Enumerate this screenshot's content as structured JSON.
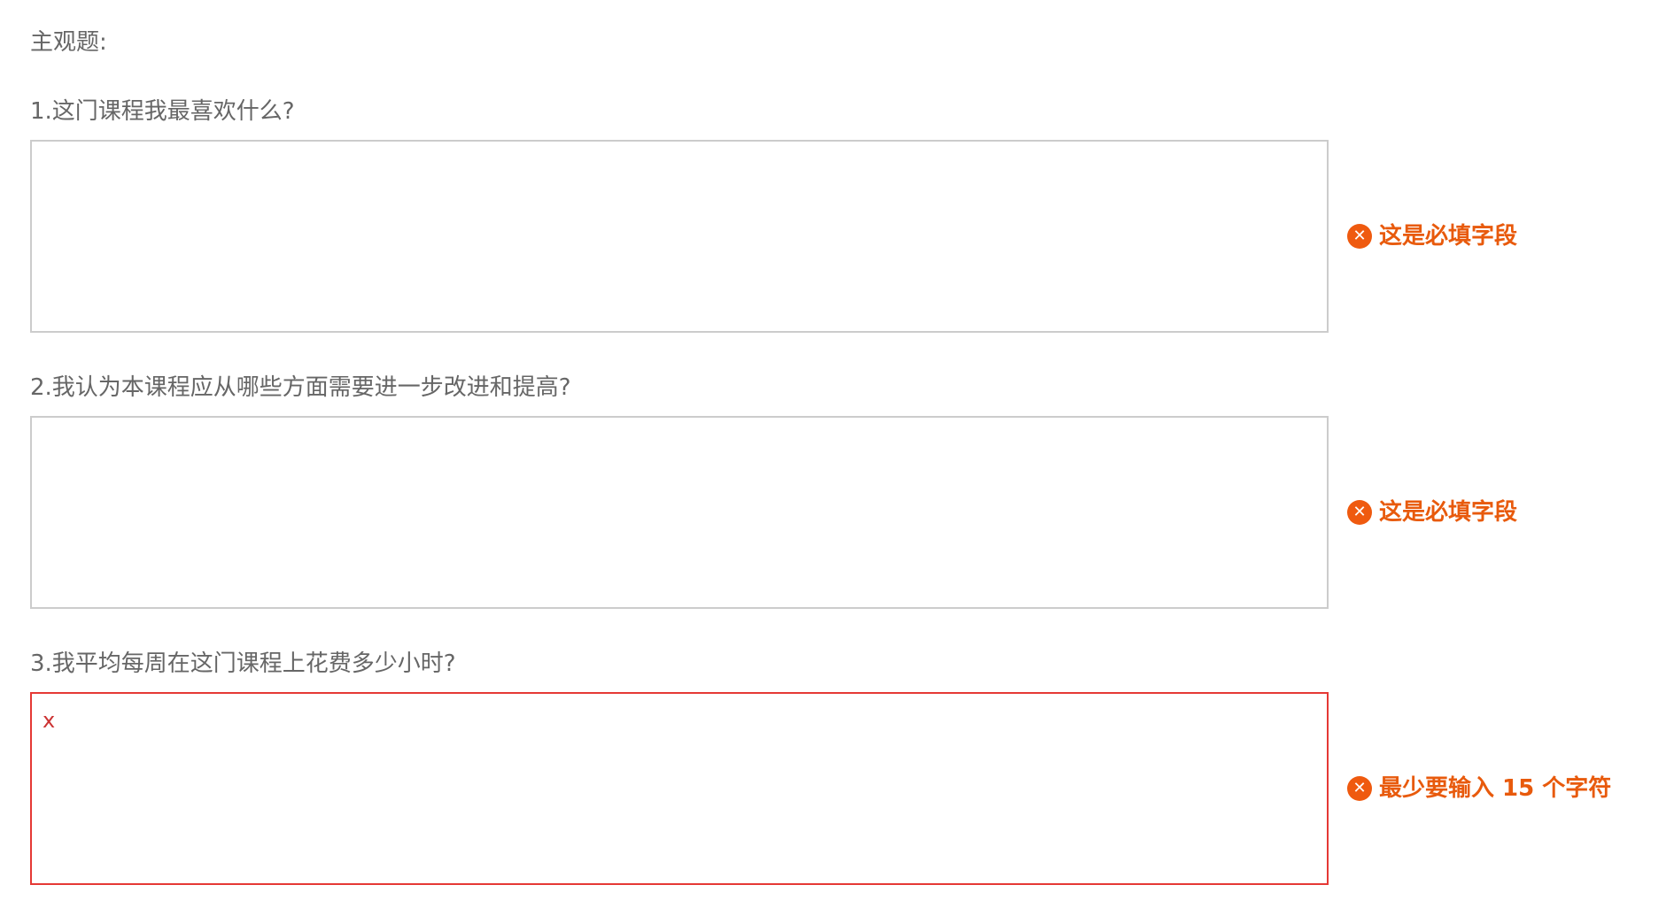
{
  "form": {
    "section_title": "主观题:",
    "questions": [
      {
        "label": "1.这门课程我最喜欢什么?",
        "value": "",
        "error": "这是必填字段"
      },
      {
        "label": "2.我认为本课程应从哪些方面需要进一步改进和提高?",
        "value": "",
        "error": "这是必填字段"
      },
      {
        "label": "3.我平均每周在这门课程上花费多少小时?",
        "value": "x",
        "error": "最少要输入 15 个字符"
      }
    ]
  },
  "icons": {
    "error_icon": "error-circle-x-icon",
    "error_icon_glyph": "✕"
  },
  "colors": {
    "label_text": "#666666",
    "box_border": "#cccccc",
    "invalid_border": "#e53935",
    "error_text": "#e85a0c",
    "error_icon_bg": "#ef5a0f"
  }
}
